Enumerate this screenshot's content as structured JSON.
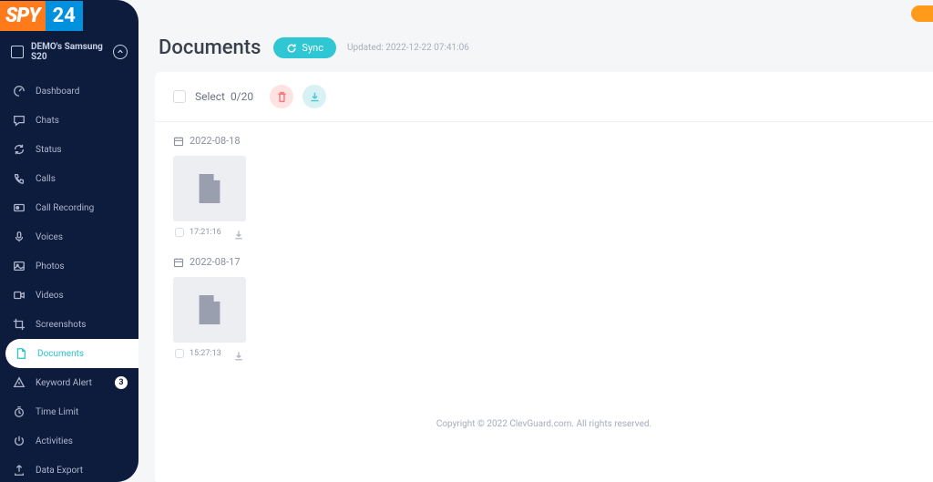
{
  "logo": {
    "part1": "SPY",
    "part2": "24"
  },
  "device_title": "DEMO's Samsung S20",
  "nav": [
    {
      "key": "dashboard",
      "label": "Dashboard",
      "icon": "speedometer"
    },
    {
      "key": "chats",
      "label": "Chats",
      "icon": "chat"
    },
    {
      "key": "status",
      "label": "Status",
      "icon": "refresh"
    },
    {
      "key": "calls",
      "label": "Calls",
      "icon": "phone"
    },
    {
      "key": "call-recording",
      "label": "Call Recording",
      "icon": "record"
    },
    {
      "key": "voices",
      "label": "Voices",
      "icon": "mic"
    },
    {
      "key": "photos",
      "label": "Photos",
      "icon": "image"
    },
    {
      "key": "videos",
      "label": "Videos",
      "icon": "video"
    },
    {
      "key": "screenshots",
      "label": "Screenshots",
      "icon": "crop"
    },
    {
      "key": "documents",
      "label": "Documents",
      "icon": "doc",
      "active": true
    },
    {
      "key": "keyword-alert",
      "label": "Keyword Alert",
      "icon": "alert",
      "badge": "3"
    },
    {
      "key": "time-limit",
      "label": "Time Limit",
      "icon": "timer"
    },
    {
      "key": "activities",
      "label": "Activities",
      "icon": "power"
    },
    {
      "key": "data-export",
      "label": "Data Export",
      "icon": "export"
    }
  ],
  "page": {
    "title": "Documents",
    "sync_label": "Sync",
    "updated_label": "Updated: 2022-12-22 07:41:06",
    "select_label": "Select",
    "select_count": "0/20",
    "footer": "Copyright © 2022 ClevGuard.com. All rights reserved."
  },
  "groups": [
    {
      "date": "2022-08-18",
      "items": [
        {
          "time": "17:21:16"
        }
      ]
    },
    {
      "date": "2022-08-17",
      "items": [
        {
          "time": "15:27:13"
        }
      ]
    }
  ]
}
